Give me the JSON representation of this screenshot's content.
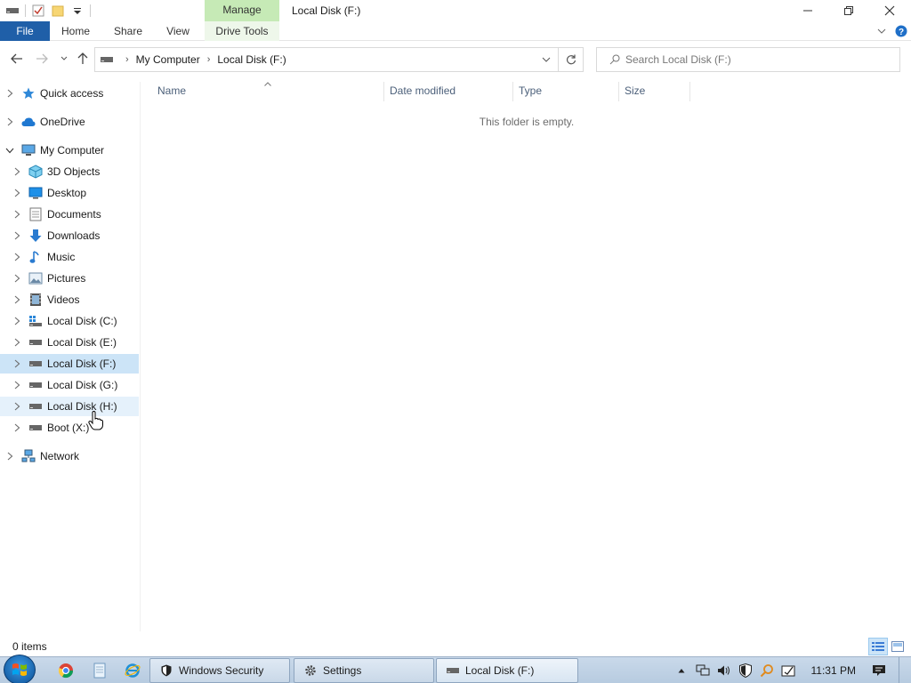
{
  "window": {
    "title": "Local Disk (F:)",
    "manage_tab": "Manage"
  },
  "ribbon": {
    "tabs": [
      "File",
      "Home",
      "Share",
      "View",
      "Drive Tools"
    ]
  },
  "address": {
    "crumbs": [
      "My Computer",
      "Local Disk (F:)"
    ]
  },
  "search": {
    "placeholder": "Search Local Disk (F:)"
  },
  "navpane": {
    "items": [
      {
        "label": "Quick access",
        "icon": "star-icon"
      },
      {
        "label": "OneDrive",
        "icon": "cloud-icon"
      },
      {
        "label": "My Computer",
        "icon": "computer-icon"
      },
      {
        "label": "3D Objects",
        "icon": "cube-icon"
      },
      {
        "label": "Desktop",
        "icon": "desktop-icon"
      },
      {
        "label": "Documents",
        "icon": "document-icon"
      },
      {
        "label": "Downloads",
        "icon": "download-icon"
      },
      {
        "label": "Music",
        "icon": "music-icon"
      },
      {
        "label": "Pictures",
        "icon": "picture-icon"
      },
      {
        "label": "Videos",
        "icon": "video-icon"
      },
      {
        "label": "Local Disk (C:)",
        "icon": "system-drive-icon"
      },
      {
        "label": "Local Disk (E:)",
        "icon": "drive-icon"
      },
      {
        "label": "Local Disk (F:)",
        "icon": "drive-icon"
      },
      {
        "label": "Local Disk (G:)",
        "icon": "drive-icon"
      },
      {
        "label": "Local Disk (H:)",
        "icon": "drive-icon"
      },
      {
        "label": "Boot (X:)",
        "icon": "drive-icon"
      },
      {
        "label": "Network",
        "icon": "network-icon"
      }
    ]
  },
  "content": {
    "columns": [
      "Name",
      "Date modified",
      "Type",
      "Size"
    ],
    "empty_message": "This folder is empty."
  },
  "status": {
    "item_count": "0 items"
  },
  "taskbar": {
    "buttons": [
      {
        "label": "Windows Security",
        "icon": "shield-icon"
      },
      {
        "label": "Settings",
        "icon": "gear-icon"
      },
      {
        "label": "Local Disk (F:)",
        "icon": "drive-icon"
      }
    ],
    "clock": "11:31 PM"
  },
  "colors": {
    "file_tab": "#1f5fa8",
    "manage_tab": "#c6eab6",
    "selected_item": "#cce4f7",
    "column_header_text": "#4c607a"
  }
}
